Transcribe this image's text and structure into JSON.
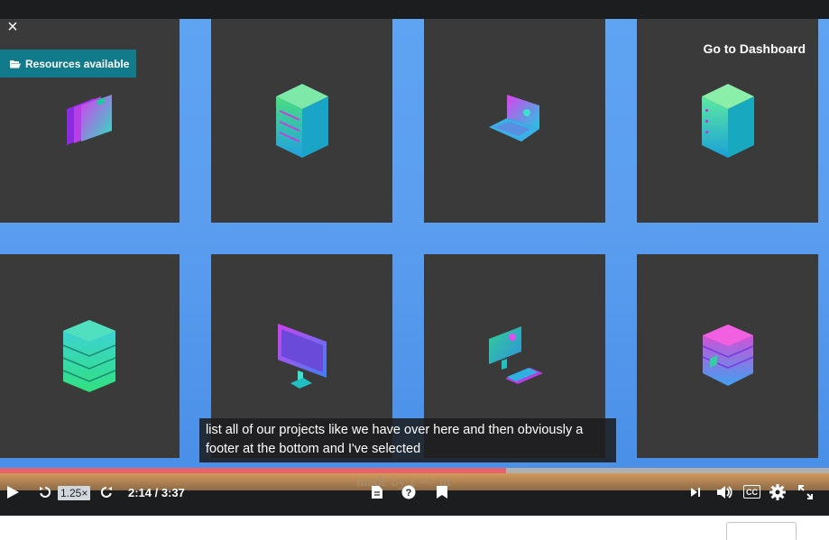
{
  "player": {
    "close_icon": "×",
    "dashboard_link": "Go to Dashboard",
    "resources_badge": "Resources available",
    "caption_lines": "list all of our projects like we have over here and then obviously a footer at the bottom and I've selected",
    "watermark": "made by z => m",
    "playback_rate": "1.25×",
    "time_display": "2:14 / 3:37",
    "progress_fraction": 0.61,
    "cc_label": "CC"
  },
  "cards": [
    {
      "icon": "folders-icon"
    },
    {
      "icon": "server-stack-icon"
    },
    {
      "icon": "laptop-icon"
    },
    {
      "icon": "server-rack-icon"
    },
    {
      "icon": "database-icon"
    },
    {
      "icon": "monitor-icon"
    },
    {
      "icon": "workstation-icon"
    },
    {
      "icon": "storage-box-icon"
    }
  ],
  "colors": {
    "accent": "#117a8b",
    "progress": "#e8626b",
    "background_blue": "#5fa3f3",
    "card": "#3a3a3a"
  }
}
